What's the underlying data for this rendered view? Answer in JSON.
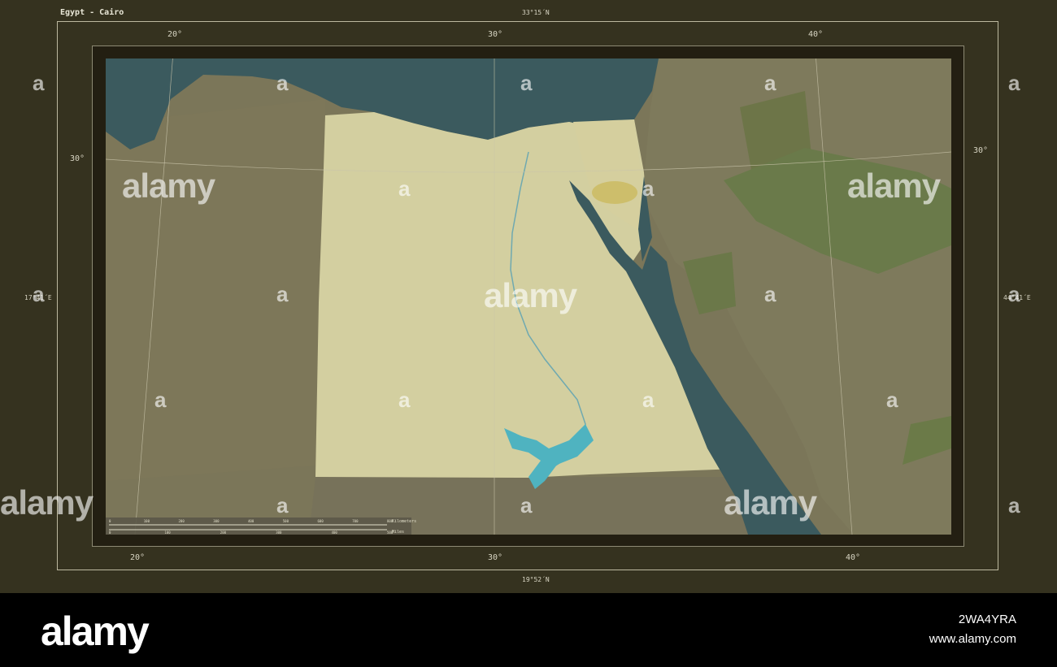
{
  "map": {
    "title": "Egypt - Cairo",
    "top_center_coord": "33°15´N",
    "bottom_center_coord": "19°52´N",
    "left_center_coord": "17°41´E",
    "right_center_coord": "44°41´E",
    "lon_top": [
      "20°",
      "30°",
      "40°"
    ],
    "lon_bottom": [
      "20°",
      "30°",
      "40°"
    ],
    "lat_left": "30°",
    "lat_right": "30°",
    "scale_units_top": "Kilometers",
    "scale_units_bottom": "Miles",
    "scale_ticks_km": [
      "0",
      "100",
      "200",
      "300",
      "400",
      "500",
      "600",
      "700",
      "800"
    ],
    "scale_ticks_mi": [
      "0",
      "100",
      "200",
      "300",
      "400",
      "500"
    ],
    "colors": {
      "sea": "#3b5a5e",
      "highlight_country": "#d3cfa0",
      "other_land": "#7b7659",
      "green_area": "#6a7a4a",
      "lake": "#4fb3c0",
      "frame": "#35321f"
    }
  },
  "watermark": {
    "brand": "alamy",
    "letter": "a"
  },
  "footer": {
    "logo": "alamy",
    "image_id": "2WA4YRA",
    "url": "www.alamy.com"
  }
}
